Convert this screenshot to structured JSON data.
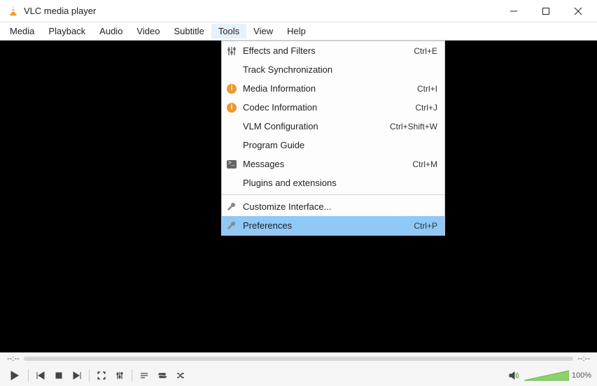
{
  "title": "VLC media player",
  "menubar": [
    "Media",
    "Playback",
    "Audio",
    "Video",
    "Subtitle",
    "Tools",
    "View",
    "Help"
  ],
  "open_menu_index": 5,
  "tools_menu": {
    "groups": [
      [
        {
          "icon": "sliders",
          "label": "Effects and Filters",
          "shortcut": "Ctrl+E"
        },
        {
          "icon": "",
          "label": "Track Synchronization",
          "shortcut": ""
        },
        {
          "icon": "info",
          "label": "Media Information",
          "shortcut": "Ctrl+I"
        },
        {
          "icon": "info",
          "label": "Codec Information",
          "shortcut": "Ctrl+J"
        },
        {
          "icon": "",
          "label": "VLM Configuration",
          "shortcut": "Ctrl+Shift+W"
        },
        {
          "icon": "",
          "label": "Program Guide",
          "shortcut": ""
        },
        {
          "icon": "terminal",
          "label": "Messages",
          "shortcut": "Ctrl+M"
        },
        {
          "icon": "",
          "label": "Plugins and extensions",
          "shortcut": ""
        }
      ],
      [
        {
          "icon": "wrench",
          "label": "Customize Interface...",
          "shortcut": ""
        },
        {
          "icon": "wrench",
          "label": "Preferences",
          "shortcut": "Ctrl+P",
          "highlight": true
        }
      ]
    ]
  },
  "seek": {
    "time_left": "--:--",
    "time_right": "--:--"
  },
  "volume": {
    "percent": "100%"
  }
}
